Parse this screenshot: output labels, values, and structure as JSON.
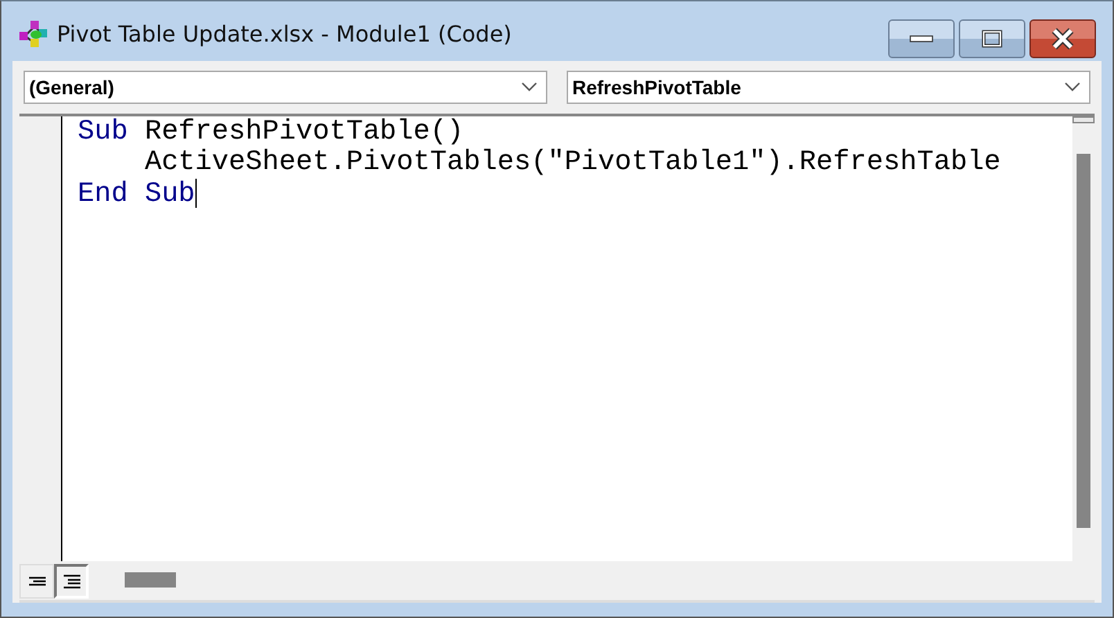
{
  "window": {
    "title": "Pivot Table Update.xlsx - Module1 (Code)"
  },
  "object_dropdown": {
    "value": "(General)"
  },
  "procedure_dropdown": {
    "value": "RefreshPivotTable"
  },
  "code_lines": [
    [
      {
        "kind": "keyword",
        "text": "Sub"
      },
      {
        "kind": "plain",
        "text": " RefreshPivotTable()"
      }
    ],
    [
      {
        "kind": "plain",
        "text": "    ActiveSheet.PivotTables(\"PivotTable1\").RefreshTable"
      }
    ],
    [
      {
        "kind": "keyword",
        "text": "End Sub",
        "caret": true
      }
    ]
  ],
  "view_buttons": [
    {
      "kind": "procedure",
      "selected": false
    },
    {
      "kind": "module",
      "selected": true
    }
  ]
}
